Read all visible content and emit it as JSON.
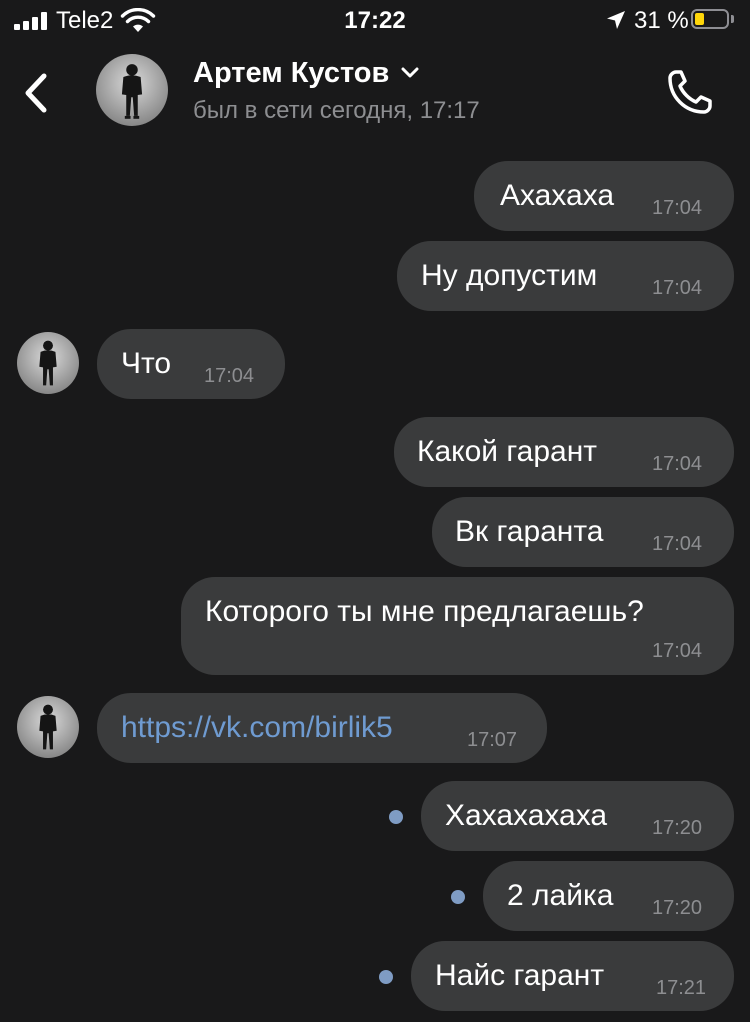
{
  "status_bar": {
    "carrier": "Tele2",
    "time": "17:22",
    "battery_percent": "31 %",
    "battery_level": 0.31,
    "icons": [
      "signal-bars-icon",
      "wifi-icon",
      "location-arrow-icon",
      "battery-icon"
    ]
  },
  "header": {
    "contact_name": "Артем Кустов",
    "contact_status": "был в сети сегодня, 17:17",
    "icons": [
      "back-chevron-icon",
      "chevron-down-icon",
      "phone-icon"
    ]
  },
  "messages": [
    {
      "direction": "outgoing",
      "text": "Ахахаха",
      "time": "17:04"
    },
    {
      "direction": "outgoing",
      "text": "Ну допустим",
      "time": "17:04"
    },
    {
      "direction": "incoming",
      "text": "Что",
      "time": "17:04"
    },
    {
      "direction": "outgoing",
      "text": "Какой гарант",
      "time": "17:04"
    },
    {
      "direction": "outgoing",
      "text": "Вк гаранта",
      "time": "17:04"
    },
    {
      "direction": "outgoing",
      "text": "Которого ты мне предлагаешь?",
      "time": "17:04"
    },
    {
      "direction": "incoming",
      "text": "https://vk.com/birlik5",
      "time": "17:07",
      "is_link": true
    },
    {
      "direction": "outgoing",
      "text": "Хахахахаха",
      "time": "17:20",
      "unread": true
    },
    {
      "direction": "outgoing",
      "text": "2 лайка",
      "time": "17:20",
      "unread": true
    },
    {
      "direction": "outgoing",
      "text": "Найс гарант",
      "time": "17:21",
      "unread": true
    }
  ],
  "colors": {
    "background": "#19191a",
    "bubble": "#3a3b3c",
    "muted_text": "#8d8e91",
    "link": "#6f9bd1",
    "unread_dot": "#7f9cc4",
    "battery": "#ffd60a"
  }
}
